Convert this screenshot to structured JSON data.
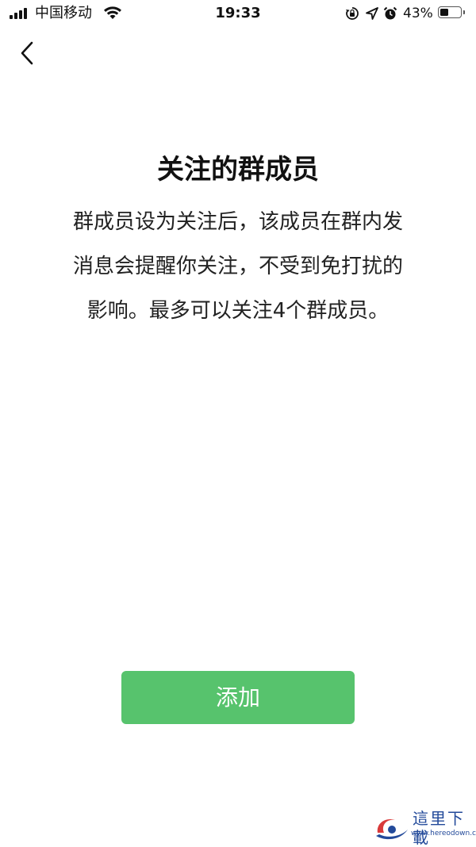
{
  "status_bar": {
    "carrier": "中国移动",
    "time": "19:33",
    "battery_percent": "43%",
    "battery_level": 0.43,
    "icons": [
      "signal-icon",
      "wifi-icon",
      "orientation-lock-icon",
      "location-icon",
      "alarm-icon",
      "battery-icon"
    ]
  },
  "nav": {
    "back_icon": "chevron-left-icon"
  },
  "main": {
    "title": "关注的群成员",
    "description_lines": [
      "群成员设为关注后，该成员在群内发",
      "消息会提醒你关注，不受到免打扰的",
      "影响。最多可以关注4个群成员。"
    ],
    "add_button_label": "添加"
  },
  "watermark": {
    "text": "這里下載",
    "url": "www.hereodown.com"
  },
  "colors": {
    "accent": "#57c36d",
    "background": "#ffffff",
    "text": "#111111"
  }
}
